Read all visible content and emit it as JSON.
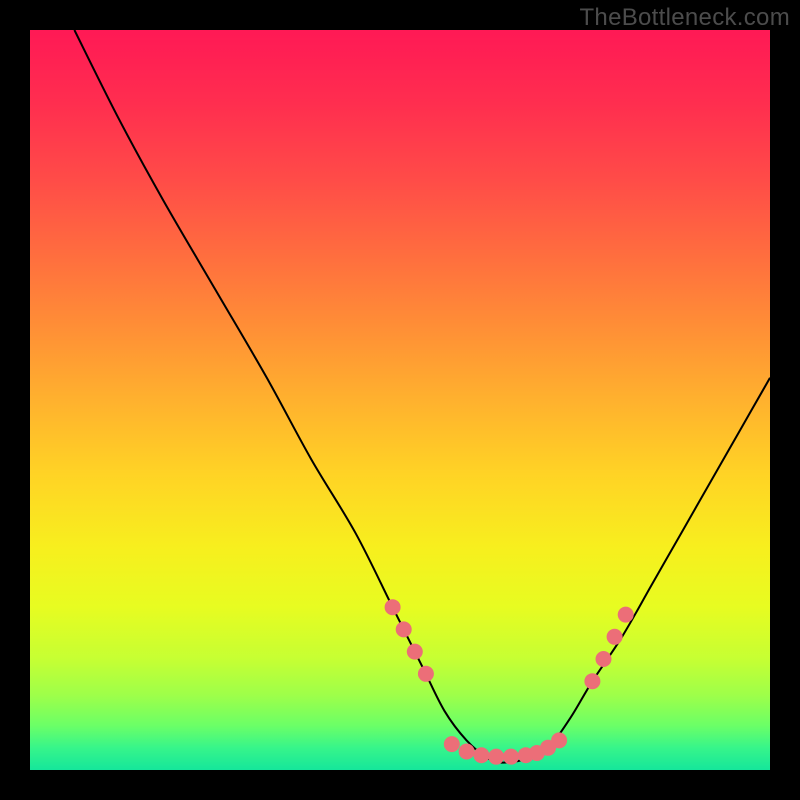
{
  "watermark": "TheBottleneck.com",
  "gradient": {
    "stops": [
      {
        "offset": 0.0,
        "color": "#ff1955"
      },
      {
        "offset": 0.1,
        "color": "#ff2e4f"
      },
      {
        "offset": 0.2,
        "color": "#ff4b48"
      },
      {
        "offset": 0.3,
        "color": "#ff6c3f"
      },
      {
        "offset": 0.4,
        "color": "#ff8e36"
      },
      {
        "offset": 0.5,
        "color": "#ffb12e"
      },
      {
        "offset": 0.6,
        "color": "#ffd325"
      },
      {
        "offset": 0.7,
        "color": "#f7ef1e"
      },
      {
        "offset": 0.78,
        "color": "#e7fc21"
      },
      {
        "offset": 0.85,
        "color": "#c6ff33"
      },
      {
        "offset": 0.9,
        "color": "#9dff4a"
      },
      {
        "offset": 0.94,
        "color": "#6bff67"
      },
      {
        "offset": 0.97,
        "color": "#37f58a"
      },
      {
        "offset": 1.0,
        "color": "#15e69b"
      }
    ]
  },
  "chart_data": {
    "type": "line",
    "title": "",
    "xlabel": "",
    "ylabel": "",
    "xlim": [
      0,
      100
    ],
    "ylim": [
      0,
      100
    ],
    "series": [
      {
        "name": "bottleneck-curve",
        "x": [
          6,
          12,
          18,
          25,
          32,
          38,
          44,
          49,
          53,
          56,
          59,
          62,
          64,
          67,
          70,
          73,
          76,
          80,
          84,
          88,
          92,
          96,
          100
        ],
        "y": [
          100,
          88,
          77,
          65,
          53,
          42,
          32,
          22,
          14,
          8,
          4,
          1.5,
          1,
          1.5,
          3,
          7,
          12,
          18,
          25,
          32,
          39,
          46,
          53
        ]
      }
    ],
    "markers": {
      "name": "highlight-dots",
      "color": "#ec6e78",
      "radius_px": 8,
      "points": [
        {
          "x": 49,
          "y": 22
        },
        {
          "x": 50.5,
          "y": 19
        },
        {
          "x": 52,
          "y": 16
        },
        {
          "x": 53.5,
          "y": 13
        },
        {
          "x": 57,
          "y": 3.5
        },
        {
          "x": 59,
          "y": 2.5
        },
        {
          "x": 61,
          "y": 2.0
        },
        {
          "x": 63,
          "y": 1.8
        },
        {
          "x": 65,
          "y": 1.8
        },
        {
          "x": 67,
          "y": 2.0
        },
        {
          "x": 68.5,
          "y": 2.3
        },
        {
          "x": 70,
          "y": 3.0
        },
        {
          "x": 71.5,
          "y": 4.0
        },
        {
          "x": 76,
          "y": 12
        },
        {
          "x": 77.5,
          "y": 15
        },
        {
          "x": 79,
          "y": 18
        },
        {
          "x": 80.5,
          "y": 21
        }
      ]
    }
  }
}
